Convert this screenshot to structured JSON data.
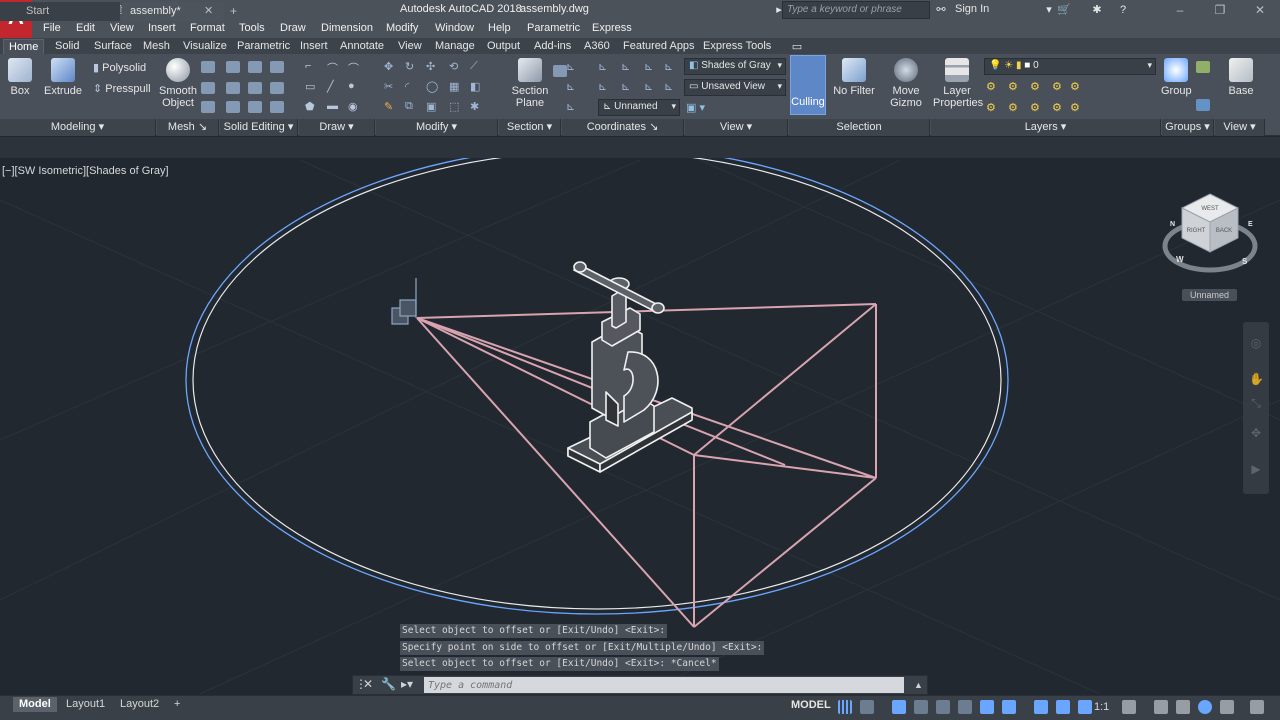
{
  "titlebar": {
    "app_title": "Autodesk AutoCAD 2018",
    "document": "assembly.dwg",
    "search_placeholder": "Type a keyword or phrase",
    "sign_in": "Sign In",
    "logo_letter": "A"
  },
  "menu": [
    "File",
    "Edit",
    "View",
    "Insert",
    "Format",
    "Tools",
    "Draw",
    "Dimension",
    "Modify",
    "Window",
    "Help",
    "Parametric",
    "Express"
  ],
  "ribbon_tabs": [
    "Home",
    "Solid",
    "Surface",
    "Mesh",
    "Visualize",
    "Parametric",
    "Insert",
    "Annotate",
    "View",
    "Manage",
    "Output",
    "Add-ins",
    "A360",
    "Featured Apps",
    "Express Tools"
  ],
  "active_tab": "Home",
  "ribbon": {
    "modeling": {
      "box": "Box",
      "extrude": "Extrude",
      "polysolid": "Polysolid",
      "presspull": "Presspull",
      "footer": "Modeling"
    },
    "mesh": {
      "smooth": "Smooth",
      "object": "Object",
      "footer": "Mesh"
    },
    "solid_editing": {
      "footer": "Solid Editing"
    },
    "draw": {
      "footer": "Draw"
    },
    "modify": {
      "footer": "Modify"
    },
    "section": {
      "plane1": "Section",
      "plane2": "Plane",
      "footer": "Section"
    },
    "coordinates": {
      "ucs": "Unnamed",
      "footer": "Coordinates"
    },
    "view": {
      "visual_style": "Shades of Gray",
      "saved_view": "Unsaved View",
      "footer": "View"
    },
    "selection": {
      "culling": "Culling",
      "no_filter": "No Filter",
      "move1": "Move",
      "move2": "Gizmo",
      "footer": "Selection"
    },
    "layers": {
      "layer1": "Layer",
      "layer2": "Properties",
      "current_layer": "0",
      "footer": "Layers"
    },
    "groups": {
      "group": "Group",
      "footer": "Groups"
    },
    "view2": {
      "base": "Base",
      "footer": "View"
    }
  },
  "file_tabs": {
    "start": "Start",
    "active": "assembly*"
  },
  "viewport": {
    "label": "[−][SW Isometric][Shades of Gray]",
    "view_name": "Unnamed",
    "cube_faces": {
      "top": "WEST",
      "right": "BACK",
      "left": "RIGHT"
    },
    "compass": {
      "n": "N",
      "w": "W",
      "s": "S",
      "e": "E"
    }
  },
  "command": {
    "history": [
      "Select object to offset or [Exit/Undo] <Exit>:",
      "Specify point on side to offset or [Exit/Multiple/Undo] <Exit>:",
      "Select object to offset or [Exit/Undo] <Exit>: *Cancel*"
    ],
    "placeholder": "Type a command"
  },
  "status": {
    "layout_tabs": [
      "Model",
      "Layout1",
      "Layout2"
    ],
    "active_layout": "Model",
    "space": "MODEL",
    "scale": "1:1"
  },
  "colors": {
    "background": "#212830",
    "ribbon": "#4a5059",
    "accent": "#5e87c7",
    "wire": "#d9a3b0",
    "circle_blue": "#6aa6ff"
  }
}
